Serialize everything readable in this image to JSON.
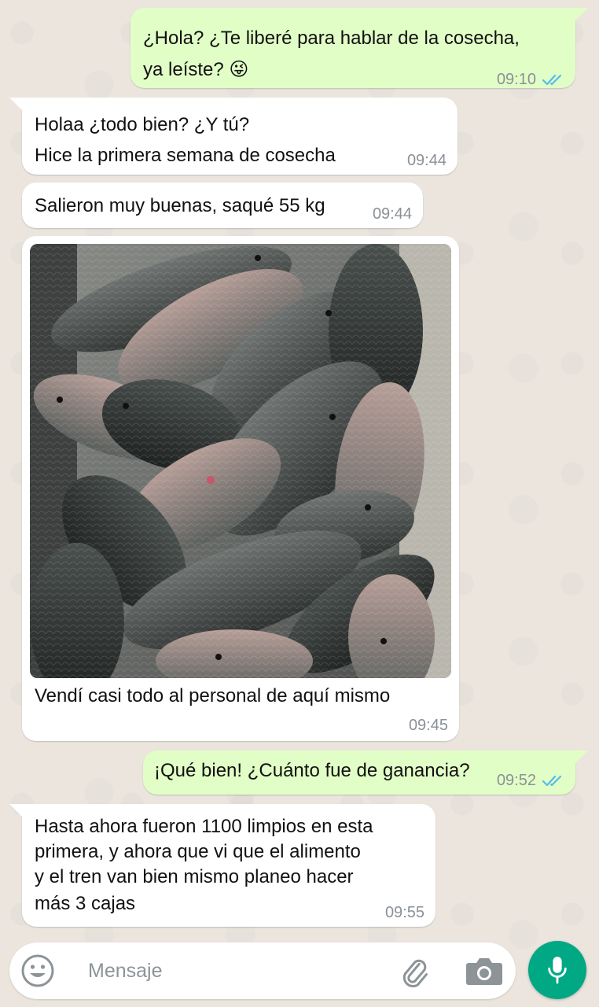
{
  "messages": [
    {
      "direction": "outgoing",
      "lines": [
        "¿Hola? ¿Te liberé para hablar de la cosecha,",
        "ya leíste? 😜"
      ],
      "time": "09:10",
      "status": "read"
    },
    {
      "direction": "incoming",
      "lines": [
        "Holaa ¿todo bien? ¿Y tú?",
        "Hice la primera semana de cosecha"
      ],
      "time": "09:44"
    },
    {
      "direction": "incoming",
      "lines": [
        "Salieron muy buenas, saqué 55 kg"
      ],
      "time": "09:44"
    },
    {
      "direction": "incoming",
      "media": "photo",
      "caption": "Vendí casi todo al personal de aquí mismo",
      "time": "09:45"
    },
    {
      "direction": "outgoing",
      "lines": [
        "¡Qué bien! ¿Cuánto fue de ganancia?"
      ],
      "time": "09:52",
      "status": "read"
    },
    {
      "direction": "incoming",
      "lines": [
        "Hasta ahora fueron 1100 limpios en esta",
        "primera, y ahora que vi que el alimento",
        "y el tren van bien mismo planeo hacer",
        "más 3 cajas"
      ],
      "time": "09:55"
    }
  ],
  "input": {
    "placeholder": "Mensaje"
  },
  "icons": {
    "emoji": "emoji-icon",
    "attach": "paperclip-icon",
    "camera": "camera-icon",
    "mic": "microphone-icon",
    "read_receipt": "double-check-icon"
  },
  "colors": {
    "outgoing_bubble": "#e2fec7",
    "incoming_bubble": "#ffffff",
    "read_ticks": "#53bdeb",
    "accent": "#00a884",
    "background": "#ebe5de"
  }
}
